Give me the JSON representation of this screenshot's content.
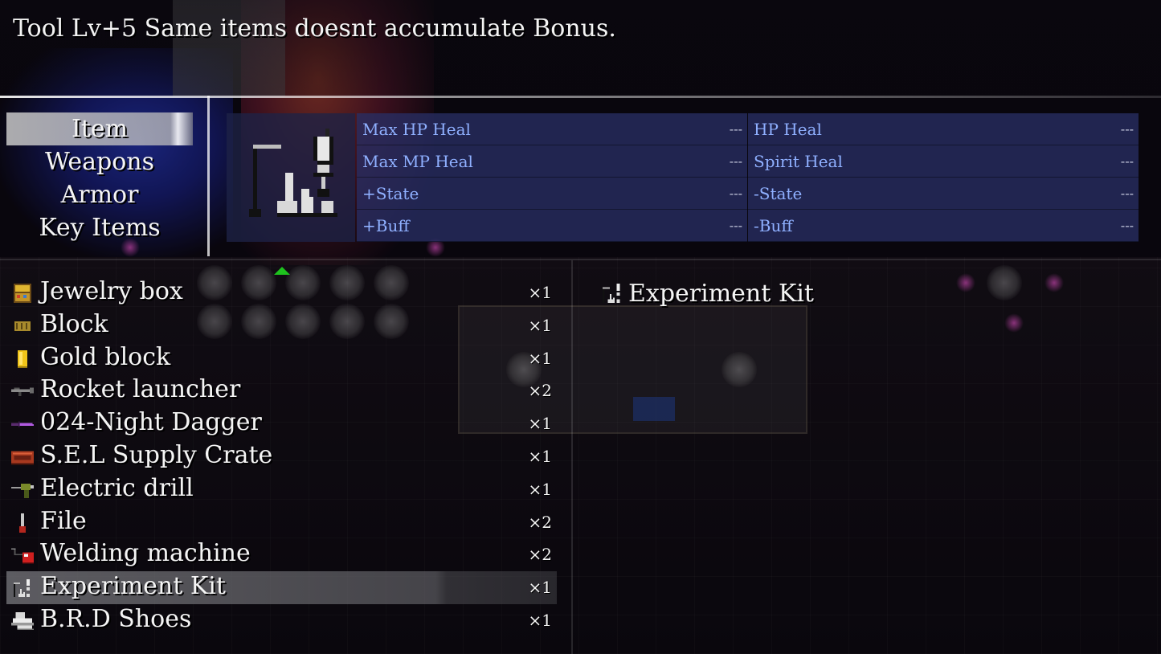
{
  "help": {
    "text": "Tool Lv+5 Same items doesnt accumulate Bonus."
  },
  "categories": [
    {
      "label": "Item",
      "selected": true
    },
    {
      "label": "Weapons",
      "selected": false
    },
    {
      "label": "Armor",
      "selected": false
    },
    {
      "label": "Key Items",
      "selected": false
    }
  ],
  "stats": {
    "max_hp_heal": {
      "label": "Max HP Heal",
      "value": "---"
    },
    "hp_heal": {
      "label": "HP Heal",
      "value": "---"
    },
    "max_mp_heal": {
      "label": "Max MP Heal",
      "value": "---"
    },
    "spirit_heal": {
      "label": "Spirit Heal",
      "value": "---"
    },
    "add_state": {
      "label": "+State",
      "value": "---"
    },
    "remove_state": {
      "label": "-State",
      "value": "---"
    },
    "add_buff": {
      "label": "+Buff",
      "value": "---"
    },
    "remove_buff": {
      "label": "-Buff",
      "value": "---"
    }
  },
  "items": [
    {
      "name": "Jewelry box",
      "qty": "×1",
      "icon": "jewelry-box-icon"
    },
    {
      "name": "Block",
      "qty": "×1",
      "icon": "block-icon"
    },
    {
      "name": "Gold block",
      "qty": "×1",
      "icon": "gold-block-icon"
    },
    {
      "name": "Rocket launcher",
      "qty": "×2",
      "icon": "rocket-launcher-icon"
    },
    {
      "name": "024-Night Dagger",
      "qty": "×1",
      "icon": "dagger-icon"
    },
    {
      "name": "S.E.L Supply Crate",
      "qty": "×1",
      "icon": "supply-crate-icon"
    },
    {
      "name": "Electric drill",
      "qty": "×1",
      "icon": "drill-icon"
    },
    {
      "name": "File",
      "qty": "×2",
      "icon": "file-tool-icon"
    },
    {
      "name": "Welding machine",
      "qty": "×2",
      "icon": "welding-machine-icon"
    },
    {
      "name": "Experiment Kit",
      "qty": "×1",
      "icon": "experiment-kit-icon",
      "selected": true
    },
    {
      "name": "B.R.D Shoes",
      "qty": "×1",
      "icon": "shoes-icon"
    }
  ],
  "detail": {
    "name": "Experiment Kit",
    "icon": "experiment-kit-icon"
  },
  "colors": {
    "stat_label": "#8fb0ff",
    "stat_bg": "#282e64",
    "scroll_arrow": "#1ec21e"
  }
}
